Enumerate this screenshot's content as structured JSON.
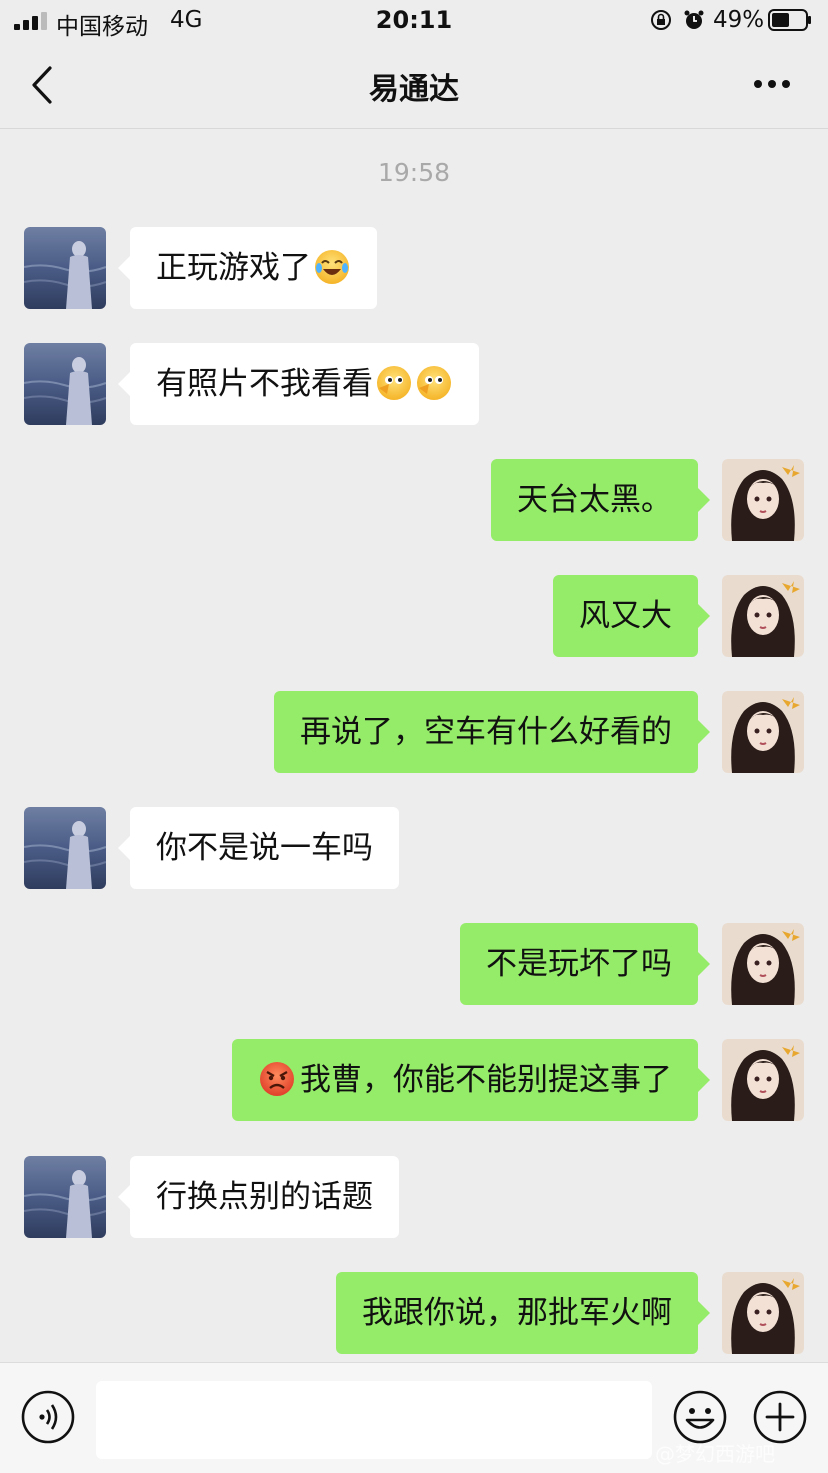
{
  "status_bar": {
    "carrier": "中国移动",
    "network": "4G",
    "time": "20:11",
    "battery_percent": "49%"
  },
  "nav": {
    "title": "易通达"
  },
  "chat": {
    "timestamp": "19:58",
    "messages": [
      {
        "side": "in",
        "text": "正玩游戏了",
        "emoji_after": "crying-laughing-emoji"
      },
      {
        "side": "in",
        "text": "有照片不我看看",
        "emoji_after": "peeking-emoji x2"
      },
      {
        "side": "out",
        "text": "天台太黑。"
      },
      {
        "side": "out",
        "text": "风又大"
      },
      {
        "side": "out",
        "text": "再说了，空车有什么好看的"
      },
      {
        "side": "in",
        "text": "你不是说一车吗"
      },
      {
        "side": "out",
        "text": "不是玩坏了吗"
      },
      {
        "side": "out",
        "text": "我曹，你能不能别提这事了",
        "emoji_before": "angry-emoji"
      },
      {
        "side": "in",
        "text": "行换点别的话题"
      },
      {
        "side": "out",
        "text": "我跟你说，那批军火啊"
      }
    ]
  },
  "input_bar": {
    "value": "",
    "icons": [
      "voice-icon",
      "emoji-smile-icon",
      "plus-icon"
    ]
  },
  "watermark": "@梦幻西游吧",
  "colors": {
    "background": "#ededed",
    "incoming_bubble": "#ffffff",
    "outgoing_bubble": "#95ec69",
    "timestamp": "#a9a9a9"
  }
}
